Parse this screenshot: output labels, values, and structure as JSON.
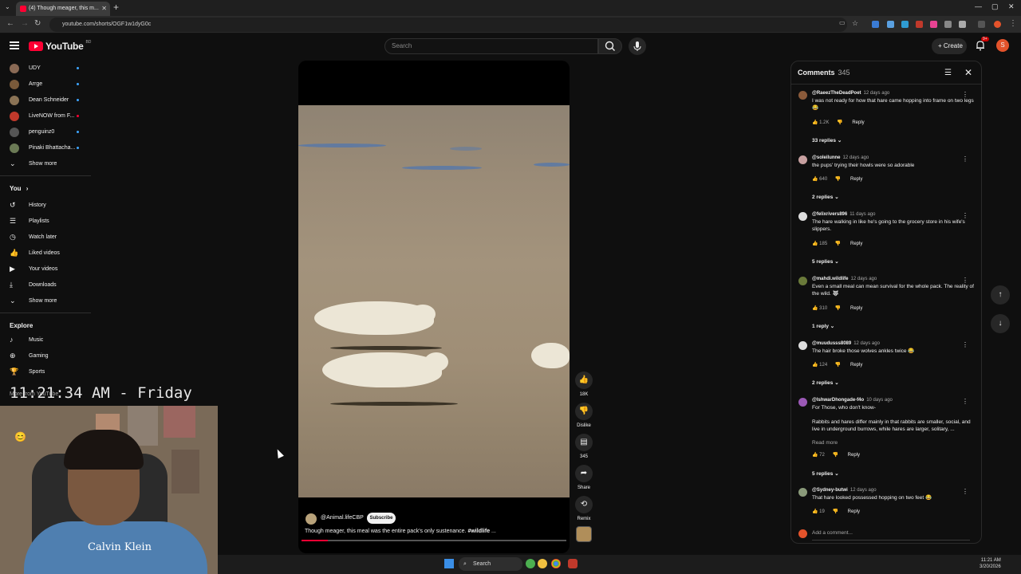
{
  "browser": {
    "tab_title": "(4) Though meager, this m...",
    "url": "youtube.com/shorts/OGF1w1dyG0c"
  },
  "header": {
    "logo_text": "YouTube",
    "logo_badge": "BD",
    "search_placeholder": "Search",
    "create_label": "Create",
    "notification_count": "9+",
    "avatar_letter": "S"
  },
  "sidebar": {
    "subscriptions": [
      {
        "name": "UDY",
        "color": "#8a6a55"
      },
      {
        "name": "Arrge",
        "color": "#7a5a3a"
      },
      {
        "name": "Dean Schneider",
        "color": "#8b7355"
      },
      {
        "name": "LiveNOW from F...",
        "color": "#c0392b"
      },
      {
        "name": "penguinz0",
        "color": "#555555"
      },
      {
        "name": "Pinaki Bhattacha...",
        "color": "#6b7a55"
      }
    ],
    "show_more_1": "Show more",
    "you_heading": "You",
    "you_items": [
      "History",
      "Playlists",
      "Watch later",
      "Liked videos",
      "Your videos",
      "Downloads"
    ],
    "show_more_2": "Show more",
    "explore_heading": "Explore",
    "explore_items": [
      "Music",
      "Gaming",
      "Sports"
    ],
    "more_heading": "More from YouTube"
  },
  "overlay": {
    "clock_text": "11:21:34 AM - Friday",
    "shirt_text": "Calvin Klein"
  },
  "video": {
    "channel": "@Animal.lifeCBP",
    "subscribe_label": "Subscribe",
    "title": "Though meager, this meal was the entire pack's only sustenance.",
    "hashtag": "#wildlife",
    "title_suffix": "...",
    "progress_fraction": 0.1
  },
  "actions": {
    "like_count": "18K",
    "dislike_label": "Dislike",
    "comment_count": "345",
    "share_label": "Share",
    "remix_label": "Remix"
  },
  "comments_panel": {
    "title": "Comments",
    "count": "345",
    "add_placeholder": "Add a comment...",
    "items": [
      {
        "user": "@RaeezTheDeadPoet",
        "time": "12 days ago",
        "text": "I was not ready for how that hare came hopping into frame on two legs 😂",
        "likes": "1.2K",
        "reply": "Reply",
        "replies": "33 replies",
        "color": "#8a5a3a"
      },
      {
        "user": "@soleilunne",
        "time": "12 days ago",
        "text": "the pups' trying their howls were so adorable",
        "likes": "640",
        "reply": "Reply",
        "replies": "2 replies",
        "color": "#c7a0a0"
      },
      {
        "user": "@felixrivers896",
        "time": "11 days ago",
        "text": "The hare walking in like he's going to the grocery store in his wife's slippers.",
        "likes": "185",
        "reply": "Reply",
        "replies": "5 replies",
        "color": "#dddddd"
      },
      {
        "user": "@mahdi.wildlife",
        "time": "12 days ago",
        "text": "Even a small meal can mean survival for the whole pack. The reality of the wild. 🐺",
        "likes": "310",
        "reply": "Reply",
        "replies": "1 reply",
        "color": "#6a7a3a"
      },
      {
        "user": "@muudusss8089",
        "time": "12 days ago",
        "text": "The hair broke those wolves ankles twice 😂",
        "likes": "124",
        "reply": "Reply",
        "replies": "2 replies",
        "color": "#dddddd"
      },
      {
        "user": "@IshwarDhongade-f4o",
        "time": "10 days ago",
        "text": "For Those, who don't know-\n\nRabbits and hares differ mainly in that rabbits are smaller, social, and live in underground burrows, while hares are larger, solitary, ...",
        "read_more": "Read more",
        "likes": "72",
        "reply": "Reply",
        "replies": "5 replies",
        "color": "#9b59b6"
      },
      {
        "user": "@Sydney-butwi",
        "time": "12 days ago",
        "text": "That hare looked possessed hopping on two feet 😂",
        "likes": "19",
        "reply": "Reply",
        "color": "#8a9a7a"
      }
    ]
  },
  "taskbar": {
    "search_label": "Search",
    "time": "11:21 AM",
    "date": "3/20/2026"
  }
}
